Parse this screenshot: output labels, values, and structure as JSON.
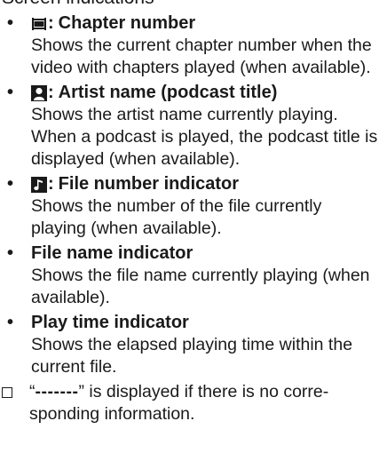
{
  "cut_heading": "Screen indications",
  "items": [
    {
      "icon": "chapter-icon",
      "title": "Chapter number",
      "desc": "Shows the current chapter number when the video with chapters played (when available)."
    },
    {
      "icon": "artist-icon",
      "title": "Artist name (podcast title)",
      "desc": "Shows the artist name currently playing. When a podcast is played, the podcast title is displayed (when available)."
    },
    {
      "icon": "music-note-icon",
      "title": "File number indicator",
      "desc": "Shows the number of the file currently playing (when available)."
    },
    {
      "icon": "",
      "title": "File name indicator",
      "desc": "Shows the file name currently playing (when available)."
    },
    {
      "icon": "",
      "title": "Play time indicator",
      "desc": "Shows the elapsed playing time within the current file."
    }
  ],
  "bullet_char": "•",
  "colon": ":",
  "note": {
    "open_quote": "“",
    "dashes": "-------",
    "close_and_text": "” is displayed if there is no corre-sponding information."
  }
}
